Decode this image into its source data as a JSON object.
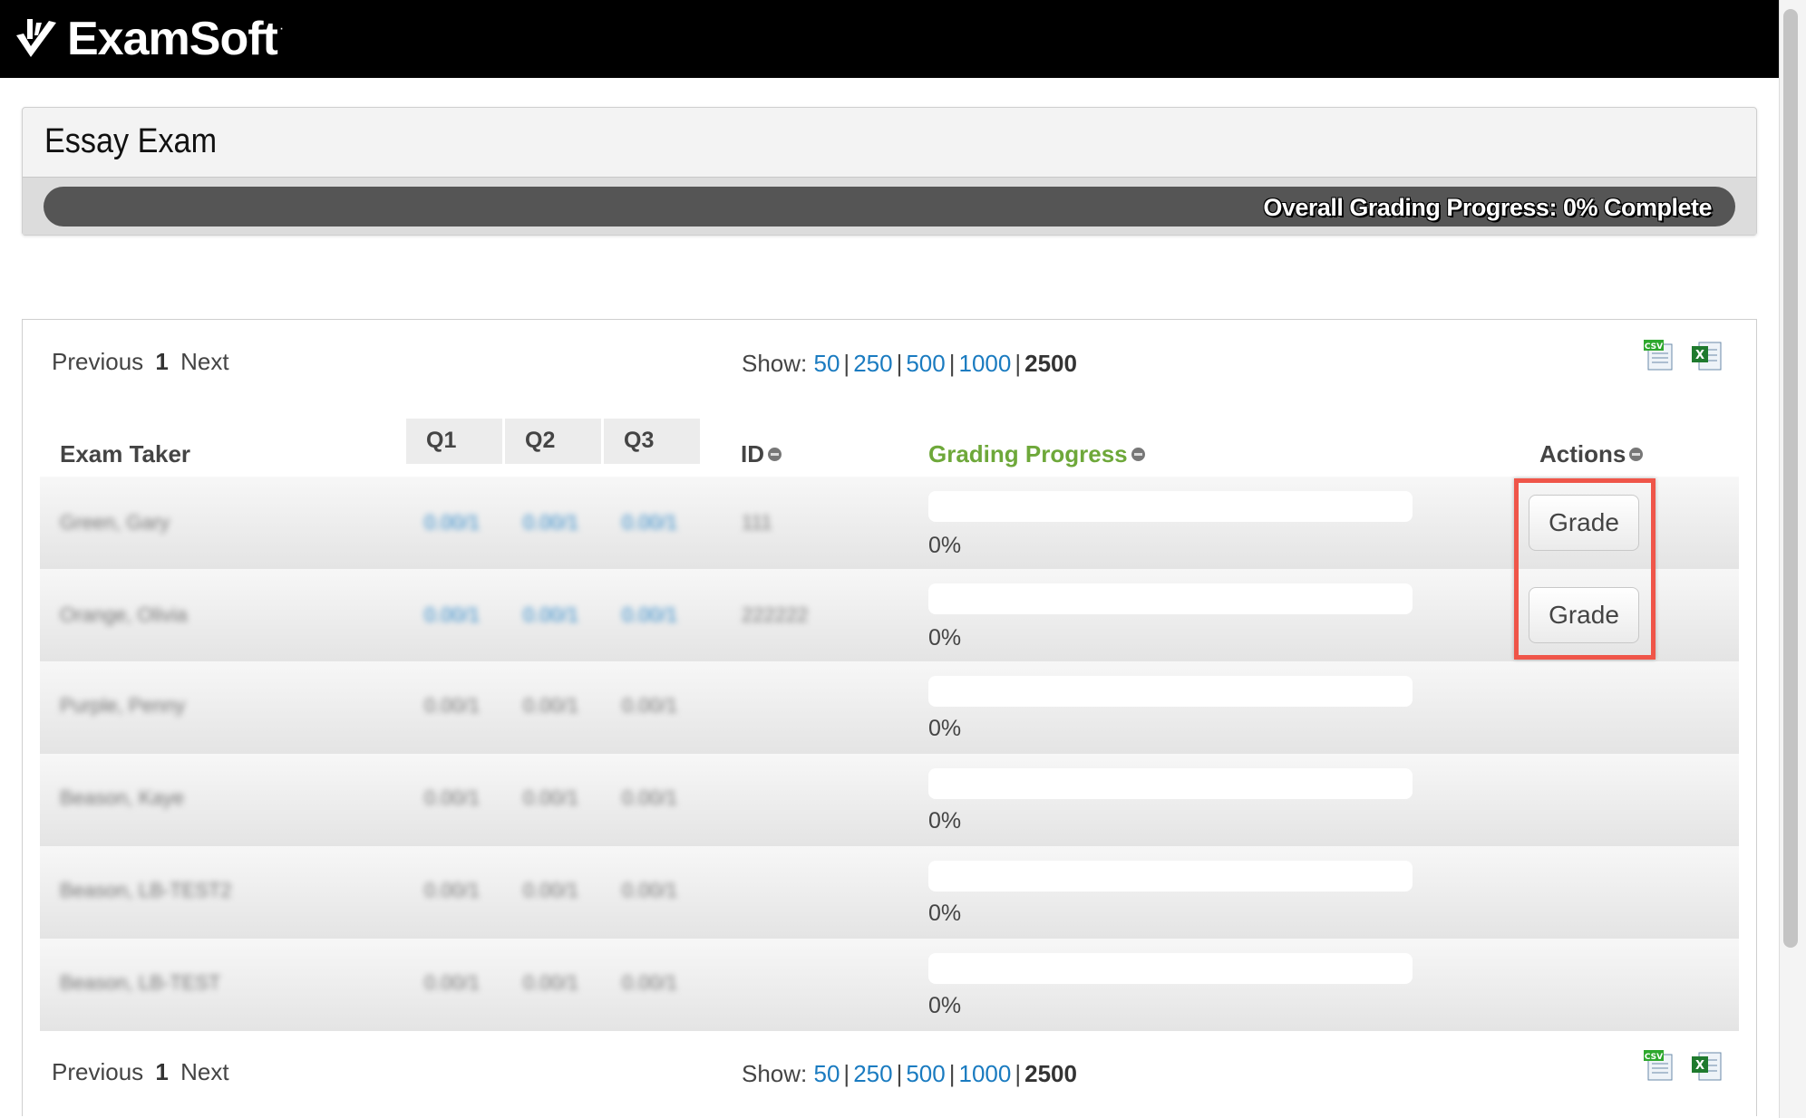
{
  "header": {
    "logo_text": "ExamSoft",
    "logo_mark": "TM"
  },
  "exam": {
    "title": "Essay Exam",
    "overall_progress_label": "Overall Grading Progress: 0% Complete",
    "overall_progress_fraction": 0
  },
  "pager_top": {
    "previous": "Previous",
    "page": "1",
    "next": "Next"
  },
  "pager_bottom": {
    "previous": "Previous",
    "page": "1",
    "next": "Next"
  },
  "show": {
    "label": "Show:",
    "options": [
      "50",
      "250",
      "500",
      "1000"
    ],
    "selected": "2500",
    "separator": "|"
  },
  "export_icons": [
    "csv-export-icon",
    "excel-export-icon"
  ],
  "table": {
    "headers": {
      "exam_taker": "Exam Taker",
      "q1": "Q1",
      "q2": "Q2",
      "q3": "Q3",
      "id": "ID",
      "grading_progress": "Grading Progress",
      "actions": "Actions"
    },
    "rows": [
      {
        "name": "Green, Gary",
        "q1": "0.00/1",
        "q2": "0.00/1",
        "q3": "0.00/1",
        "id": "111",
        "progress": "0%",
        "progress_fraction": 0,
        "action": "Grade"
      },
      {
        "name": "Orange, Olivia",
        "q1": "0.00/1",
        "q2": "0.00/1",
        "q3": "0.00/1",
        "id": "222222",
        "progress": "0%",
        "progress_fraction": 0,
        "action": "Grade"
      },
      {
        "name": "Purple, Penny",
        "q1": "0.00/1",
        "q2": "0.00/1",
        "q3": "0.00/1",
        "id": "",
        "progress": "0%",
        "progress_fraction": 0,
        "action": ""
      },
      {
        "name": "Beason, Kaye",
        "q1": "0.00/1",
        "q2": "0.00/1",
        "q3": "0.00/1",
        "id": "",
        "progress": "0%",
        "progress_fraction": 0,
        "action": ""
      },
      {
        "name": "Beason, LB-TEST2",
        "q1": "0.00/1",
        "q2": "0.00/1",
        "q3": "0.00/1",
        "id": "",
        "progress": "0%",
        "progress_fraction": 0,
        "action": ""
      },
      {
        "name": "Beason, LB-TEST",
        "q1": "0.00/1",
        "q2": "0.00/1",
        "q3": "0.00/1",
        "id": "",
        "progress": "0%",
        "progress_fraction": 0,
        "action": ""
      }
    ]
  },
  "colors": {
    "link_blue": "#1a7bc0",
    "progress_header_green": "#6ea83a",
    "highlight_red": "#ef5549",
    "overall_bar": "#555555"
  }
}
